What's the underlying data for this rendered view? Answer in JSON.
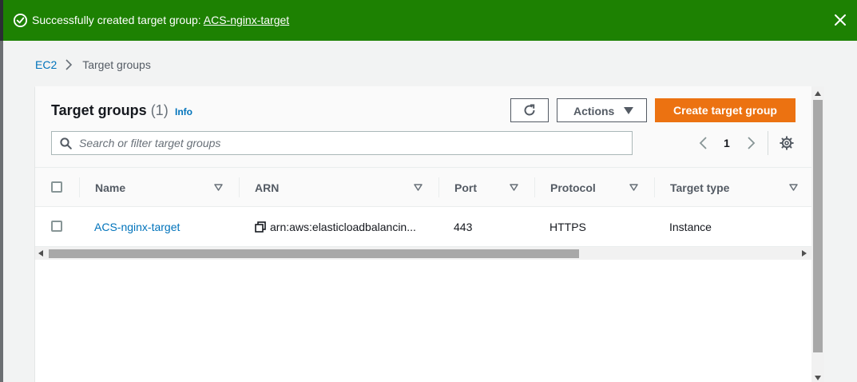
{
  "banner": {
    "message": "Successfully created target group: ",
    "link_text": "ACS-nginx-target",
    "color": "#1d8102",
    "icons": {
      "status": "check-circle-icon",
      "close": "close-icon"
    }
  },
  "breadcrumb": {
    "items": [
      {
        "label": "EC2"
      },
      {
        "label": "Target groups"
      }
    ]
  },
  "panel": {
    "title": "Target groups",
    "count": "(1)",
    "info_label": "Info",
    "actions_label": "Actions",
    "create_label": "Create target group",
    "search": {
      "placeholder": "Search or filter target groups",
      "value": ""
    },
    "pagination": {
      "current_page": "1"
    },
    "accent_color": "#ec7211"
  },
  "table": {
    "columns": [
      "Name",
      "ARN",
      "Port",
      "Protocol",
      "Target type"
    ],
    "rows": [
      {
        "name": "ACS-nginx-target",
        "arn": "arn:aws:elasticloadbalancin...",
        "port": "443",
        "protocol": "HTTPS",
        "target_type": "Instance"
      }
    ]
  }
}
